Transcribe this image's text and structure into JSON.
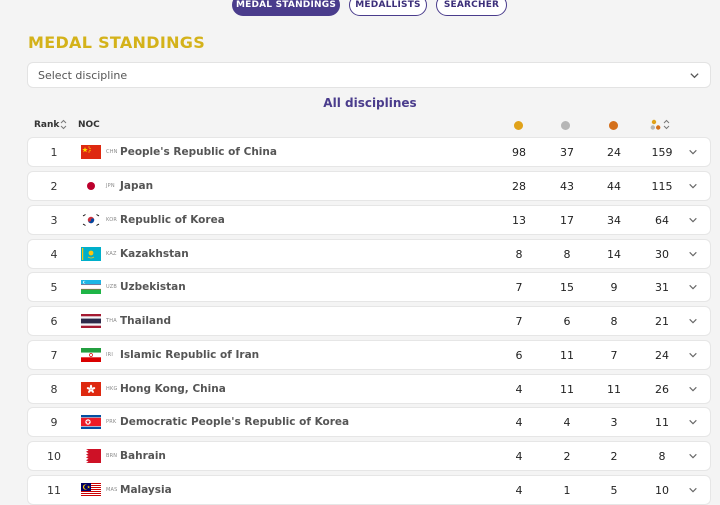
{
  "tabs": [
    {
      "label": "MEDAL STANDINGS",
      "active": true
    },
    {
      "label": "MEDALLISTS",
      "active": false
    },
    {
      "label": "SEARCHER",
      "active": false
    }
  ],
  "title": "MEDAL STANDINGS",
  "discipline_select": {
    "placeholder": "Select discipline"
  },
  "subtitle": "All disciplines",
  "columns": {
    "rank": "Rank",
    "noc": "NOC"
  },
  "colors": {
    "gold": "#e0a21a",
    "silver": "#b6b6b6",
    "bronze": "#d4701c",
    "accent": "#4a3c8c",
    "title": "#d4b21a"
  },
  "rows": [
    {
      "rank": "1",
      "code": "CHN",
      "name": "People's Republic of China",
      "gold": "98",
      "silver": "37",
      "bronze": "24",
      "total": "159",
      "flag": "chn"
    },
    {
      "rank": "2",
      "code": "JPN",
      "name": "Japan",
      "gold": "28",
      "silver": "43",
      "bronze": "44",
      "total": "115",
      "flag": "jpn"
    },
    {
      "rank": "3",
      "code": "KOR",
      "name": "Republic of Korea",
      "gold": "13",
      "silver": "17",
      "bronze": "34",
      "total": "64",
      "flag": "kor"
    },
    {
      "rank": "4",
      "code": "KAZ",
      "name": "Kazakhstan",
      "gold": "8",
      "silver": "8",
      "bronze": "14",
      "total": "30",
      "flag": "kaz"
    },
    {
      "rank": "5",
      "code": "UZB",
      "name": "Uzbekistan",
      "gold": "7",
      "silver": "15",
      "bronze": "9",
      "total": "31",
      "flag": "uzb"
    },
    {
      "rank": "6",
      "code": "THA",
      "name": "Thailand",
      "gold": "7",
      "silver": "6",
      "bronze": "8",
      "total": "21",
      "flag": "tha"
    },
    {
      "rank": "7",
      "code": "IRI",
      "name": "Islamic Republic of Iran",
      "gold": "6",
      "silver": "11",
      "bronze": "7",
      "total": "24",
      "flag": "iri"
    },
    {
      "rank": "8",
      "code": "HKG",
      "name": "Hong Kong, China",
      "gold": "4",
      "silver": "11",
      "bronze": "11",
      "total": "26",
      "flag": "hkg"
    },
    {
      "rank": "9",
      "code": "PRK",
      "name": "Democratic People's Republic of Korea",
      "gold": "4",
      "silver": "4",
      "bronze": "3",
      "total": "11",
      "flag": "prk"
    },
    {
      "rank": "10",
      "code": "BRN",
      "name": "Bahrain",
      "gold": "4",
      "silver": "2",
      "bronze": "2",
      "total": "8",
      "flag": "brn"
    },
    {
      "rank": "11",
      "code": "MAS",
      "name": "Malaysia",
      "gold": "4",
      "silver": "1",
      "bronze": "5",
      "total": "10",
      "flag": "mas"
    }
  ]
}
